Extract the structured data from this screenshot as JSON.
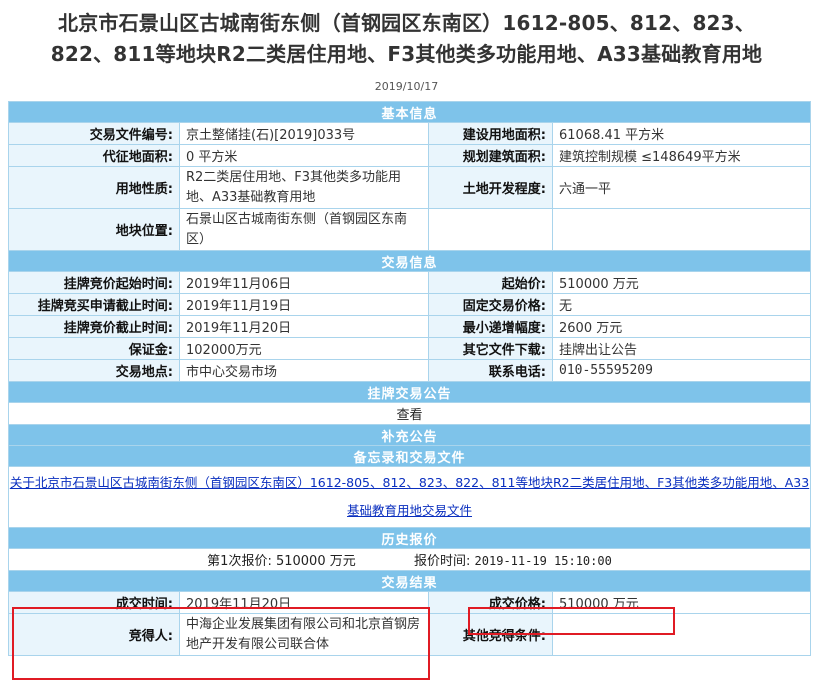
{
  "title_line1": "北京市石景山区古城南街东侧（首钢园区东南区）1612-805、812、823、",
  "title_line2": "822、811等地块R2二类居住用地、F3其他类多功能用地、A33基础教育用地",
  "date": "2019/10/17",
  "sections": {
    "basic": "基本信息",
    "trade": "交易信息",
    "listing": "挂牌交易公告",
    "supplement": "补充公告",
    "memo": "备忘录和交易文件",
    "history": "历史报价",
    "result": "交易结果"
  },
  "basic": {
    "doc_no_label": "交易文件编号:",
    "doc_no": "京土整储挂(石)[2019]033号",
    "land_area_label": "建设用地面积:",
    "land_area": "61068.41 平方米",
    "proxy_area_label": "代征地面积:",
    "proxy_area": "0 平方米",
    "plan_area_label": "规划建筑面积:",
    "plan_area": "建筑控制规模 ≤148649平方米",
    "usage_label": "用地性质:",
    "usage": "R2二类居住用地、F3其他类多功能用地、A33基础教育用地",
    "dev_label": "土地开发程度:",
    "dev": "六通一平",
    "location_label": "地块位置:",
    "location": "石景山区古城南街东侧（首钢园区东南区）"
  },
  "trade": {
    "start_time_label": "挂牌竞价起始时间:",
    "start_time": "2019年11月06日",
    "start_price_label": "起始价:",
    "start_price": "510000 万元",
    "apply_deadline_label": "挂牌竞买申请截止时间:",
    "apply_deadline": "2019年11月19日",
    "fixed_price_label": "固定交易价格:",
    "fixed_price": "无",
    "end_time_label": "挂牌竞价截止时间:",
    "end_time": "2019年11月20日",
    "min_increment_label": "最小递增幅度:",
    "min_increment": "2600 万元",
    "deposit_label": "保证金:",
    "deposit": "102000万元",
    "other_docs_label": "其它文件下载:",
    "other_docs": "挂牌出让公告",
    "venue_label": "交易地点:",
    "venue": "市中心交易市场",
    "phone_label": "联系电话:",
    "phone": "010-55595209"
  },
  "listing_view": "查看",
  "memo_link": "关于北京市石景山区古城南街东侧（首钢园区东南区）1612-805、812、823、822、811等地块R2二类居住用地、F3其他类多功能用地、A33基础教育用地交易文件",
  "history": {
    "round_label": "第1次报价:",
    "round_value": "510000 万元",
    "time_label": "报价时间:",
    "time_value": "2019-11-19 15:10:00"
  },
  "result": {
    "deal_time_label": "成交时间:",
    "deal_time": "2019年11月20日",
    "deal_price_label": "成交价格:",
    "deal_price": "510000 万元",
    "winner_label": "竞得人:",
    "winner": "中海企业发展集团有限公司和北京首钢房地产开发有限公司联合体",
    "other_cond_label": "其他竞得条件:",
    "other_cond": ""
  },
  "highlight_color": "#e01b24",
  "section_color": "#7ec3ea"
}
